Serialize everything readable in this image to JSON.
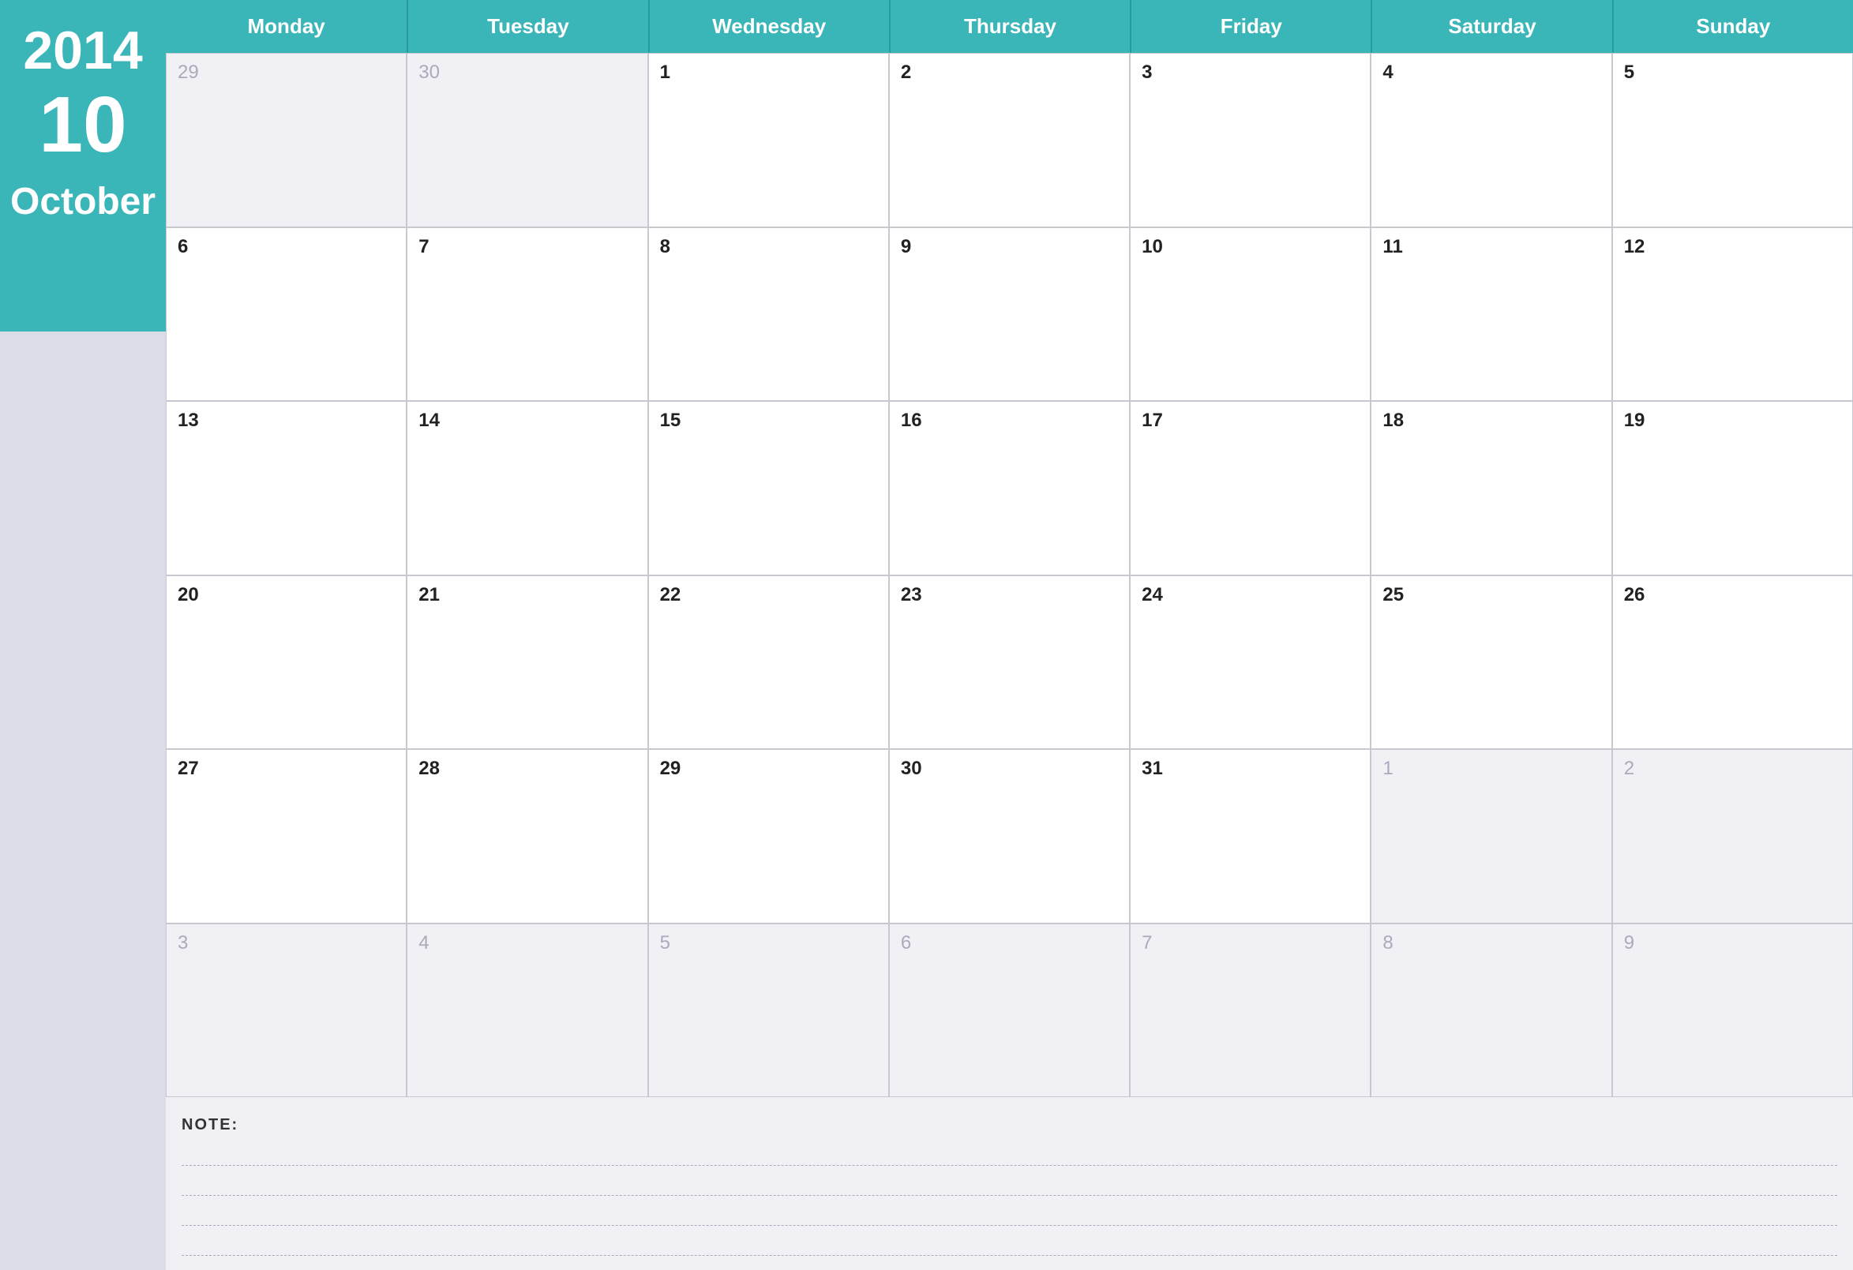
{
  "sidebar": {
    "year": "2014",
    "month_number": "10",
    "month_name": "October"
  },
  "header": {
    "days": [
      "Monday",
      "Tuesday",
      "Wednesday",
      "Thursday",
      "Friday",
      "Saturday",
      "Sunday"
    ]
  },
  "calendar": {
    "weeks": [
      [
        {
          "day": "29",
          "other": true
        },
        {
          "day": "30",
          "other": true
        },
        {
          "day": "1",
          "other": false
        },
        {
          "day": "2",
          "other": false
        },
        {
          "day": "3",
          "other": false
        },
        {
          "day": "4",
          "other": false
        },
        {
          "day": "5",
          "other": false
        }
      ],
      [
        {
          "day": "6",
          "other": false
        },
        {
          "day": "7",
          "other": false
        },
        {
          "day": "8",
          "other": false
        },
        {
          "day": "9",
          "other": false
        },
        {
          "day": "10",
          "other": false
        },
        {
          "day": "11",
          "other": false
        },
        {
          "day": "12",
          "other": false
        }
      ],
      [
        {
          "day": "13",
          "other": false
        },
        {
          "day": "14",
          "other": false
        },
        {
          "day": "15",
          "other": false
        },
        {
          "day": "16",
          "other": false
        },
        {
          "day": "17",
          "other": false
        },
        {
          "day": "18",
          "other": false
        },
        {
          "day": "19",
          "other": false
        }
      ],
      [
        {
          "day": "20",
          "other": false
        },
        {
          "day": "21",
          "other": false
        },
        {
          "day": "22",
          "other": false
        },
        {
          "day": "23",
          "other": false
        },
        {
          "day": "24",
          "other": false
        },
        {
          "day": "25",
          "other": false
        },
        {
          "day": "26",
          "other": false
        }
      ],
      [
        {
          "day": "27",
          "other": false
        },
        {
          "day": "28",
          "other": false
        },
        {
          "day": "29",
          "other": false
        },
        {
          "day": "30",
          "other": false
        },
        {
          "day": "31",
          "other": false
        },
        {
          "day": "1",
          "other": true
        },
        {
          "day": "2",
          "other": true
        }
      ],
      [
        {
          "day": "3",
          "other": true
        },
        {
          "day": "4",
          "other": true
        },
        {
          "day": "5",
          "other": true
        },
        {
          "day": "6",
          "other": true
        },
        {
          "day": "7",
          "other": true
        },
        {
          "day": "8",
          "other": true
        },
        {
          "day": "9",
          "other": true
        }
      ]
    ]
  },
  "notes": {
    "label": "NOTE:",
    "lines": 4
  }
}
